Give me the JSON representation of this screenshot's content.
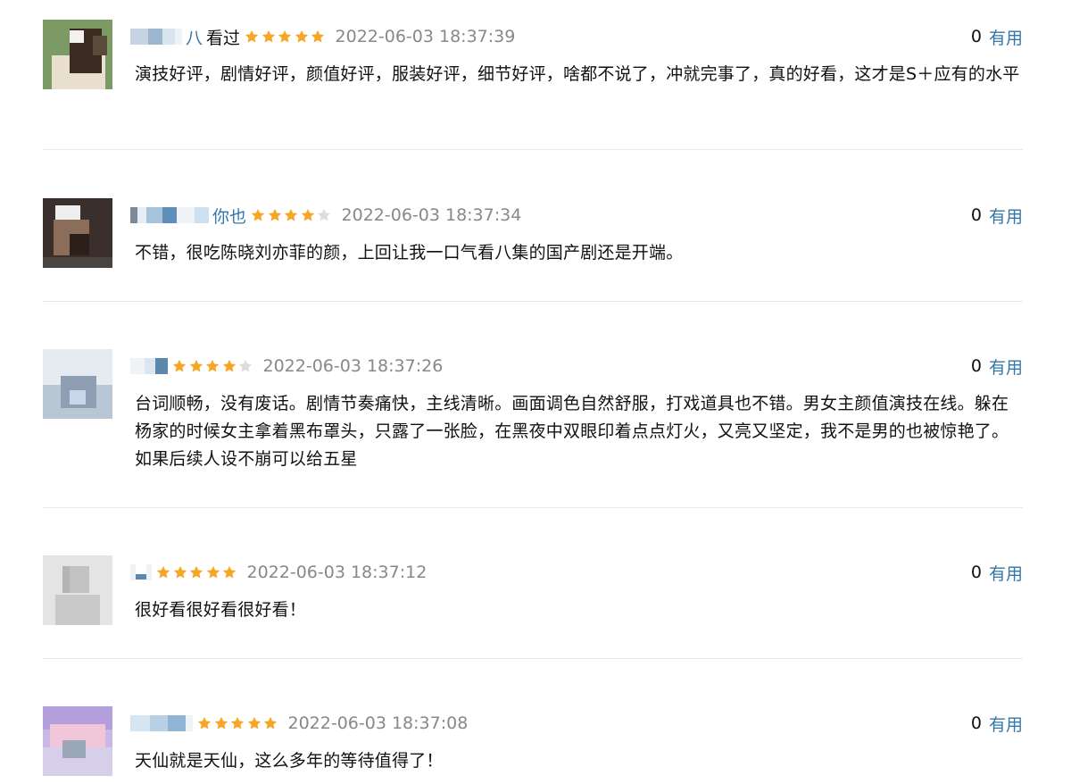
{
  "reviews": [
    {
      "name_suffix": "八",
      "status": "看过",
      "rating": 5,
      "time": "2022-06-03 18:37:39",
      "useful_count": "0",
      "useful_label": "有用",
      "content": "演技好评，剧情好评，颜值好评，服装好评，细节好评，啥都不说了，冲就完事了，真的好看，这才是S＋应有的水平"
    },
    {
      "name_suffix": "你也",
      "status": "",
      "rating": 4,
      "time": "2022-06-03 18:37:34",
      "useful_count": "0",
      "useful_label": "有用",
      "content": "不错，很吃陈晓刘亦菲的颜，上回让我一口气看八集的国产剧还是开端。"
    },
    {
      "name_suffix": "",
      "status": "",
      "rating": 4,
      "time": "2022-06-03 18:37:26",
      "useful_count": "0",
      "useful_label": "有用",
      "content": "台词顺畅，没有废话。剧情节奏痛快，主线清晰。画面调色自然舒服，打戏道具也不错。男女主颜值演技在线。躲在杨家的时候女主拿着黑布罩头，只露了一张脸，在黑夜中双眼印着点点灯火，又亮又坚定，我不是男的也被惊艳了。如果后续人设不崩可以给五星"
    },
    {
      "name_suffix": "",
      "status": "",
      "rating": 5,
      "time": "2022-06-03 18:37:12",
      "useful_count": "0",
      "useful_label": "有用",
      "content": "很好看很好看很好看！"
    },
    {
      "name_suffix": "",
      "status": "",
      "rating": 5,
      "time": "2022-06-03 18:37:08",
      "useful_count": "0",
      "useful_label": "有用",
      "content": "天仙就是天仙，这么多年的等待值得了！"
    }
  ],
  "colors": {
    "star_on": "#f6a623",
    "star_off": "#dcdcdc",
    "link": "#3377aa",
    "date": "#888888",
    "divider": "#e9e9e9"
  }
}
